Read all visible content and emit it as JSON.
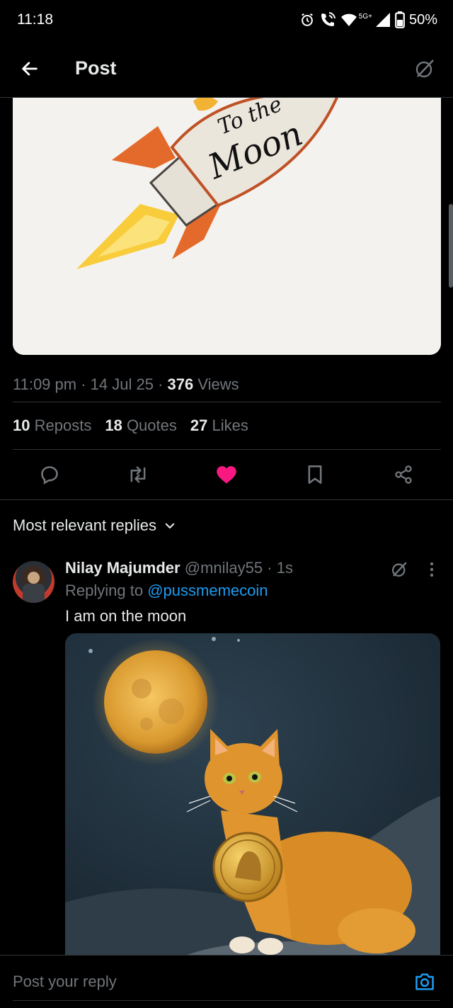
{
  "status_bar": {
    "time": "11:18",
    "network": "5G+",
    "battery": "50%",
    "icons": [
      "alarm-icon",
      "wifi-calling-icon",
      "wifi-icon",
      "signal-icon",
      "battery-icon"
    ]
  },
  "header": {
    "title": "Post",
    "back_icon": "arrow-left-icon",
    "grok_icon": "grok-icon"
  },
  "post": {
    "image_text_line1": "To the",
    "image_text_line2": "Moon",
    "time": "11:09 pm",
    "date": "14 Jul 25",
    "views_count": "376",
    "views_label": "Views",
    "reposts_count": "10",
    "reposts_label": "Reposts",
    "quotes_count": "18",
    "quotes_label": "Quotes",
    "likes_count": "27",
    "likes_label": "Likes"
  },
  "actions": [
    {
      "name": "reply-icon"
    },
    {
      "name": "repost-icon"
    },
    {
      "name": "like-icon",
      "active": true,
      "color": "#f91880"
    },
    {
      "name": "bookmark-icon"
    },
    {
      "name": "share-icon"
    }
  ],
  "replies_sort": {
    "label": "Most relevant replies",
    "icon": "chevron-down-icon"
  },
  "reply": {
    "name": "Nilay Majumder",
    "handle": "@mnilay55",
    "separator": "·",
    "time": "1s",
    "replying_prefix": "Replying to",
    "replying_handle": "@pussmemecoin",
    "text": "I am on the moon"
  },
  "composer": {
    "placeholder": "Post your reply",
    "camera_icon": "camera-icon"
  },
  "colors": {
    "background": "#000000",
    "text": "#e7e9ea",
    "muted": "#71767b",
    "link": "#1d9bf0",
    "like": "#f91880",
    "divider": "#2f3336"
  }
}
